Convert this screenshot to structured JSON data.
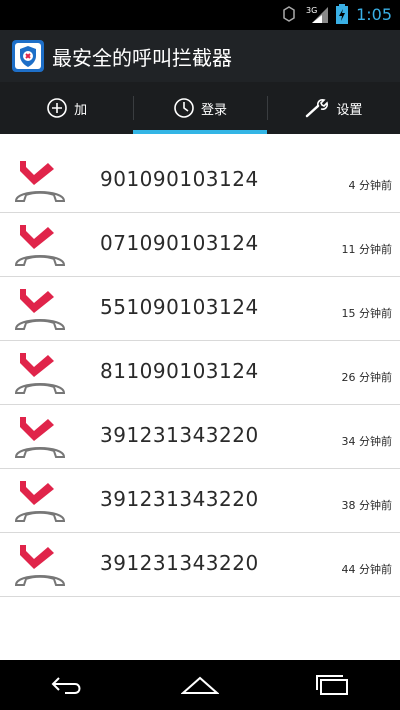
{
  "status_bar": {
    "network_label": "3G",
    "time": "1:05"
  },
  "app": {
    "title": "最安全的呼叫拦截器",
    "icon": "shield-phone-icon"
  },
  "tabs": [
    {
      "label": "加",
      "icon": "plus-circle-icon",
      "active": false
    },
    {
      "label": "登录",
      "icon": "clock-icon",
      "active": true
    },
    {
      "label": "设置",
      "icon": "wrench-icon",
      "active": false
    }
  ],
  "calls": [
    {
      "number": "901090103124",
      "time": "4 分钟前",
      "icon": "missed-call-icon"
    },
    {
      "number": "071090103124",
      "time": "11 分钟前",
      "icon": "missed-call-icon"
    },
    {
      "number": "551090103124",
      "time": "15 分钟前",
      "icon": "missed-call-icon"
    },
    {
      "number": "811090103124",
      "time": "26 分钟前",
      "icon": "missed-call-icon"
    },
    {
      "number": "391231343220",
      "time": "34 分钟前",
      "icon": "missed-call-icon"
    },
    {
      "number": "391231343220",
      "time": "38 分钟前",
      "icon": "missed-call-icon"
    },
    {
      "number": "391231343220",
      "time": "44 分钟前",
      "icon": "missed-call-icon"
    }
  ],
  "nav": [
    {
      "icon": "back-icon"
    },
    {
      "icon": "home-icon"
    },
    {
      "icon": "recent-apps-icon"
    }
  ],
  "colors": {
    "accent": "#33b5e5",
    "missed_call_red": "#e0244a",
    "title_bar_bg": "#202326"
  }
}
